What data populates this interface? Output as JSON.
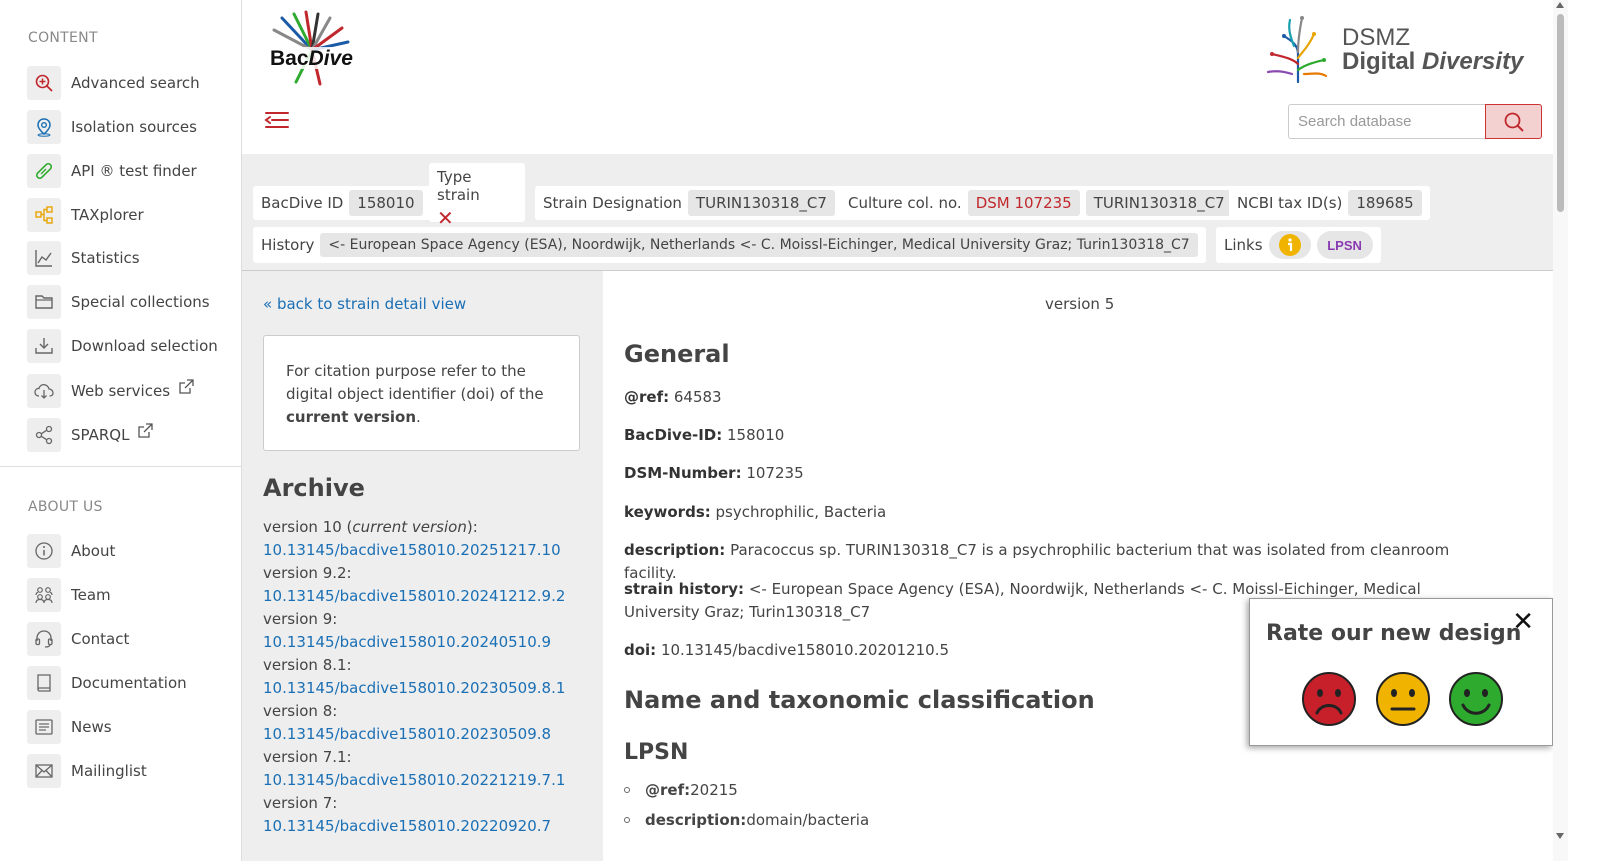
{
  "sidebar": {
    "content_heading": "CONTENT",
    "content_items": [
      {
        "label": "Advanced search",
        "icon": "search-plus-icon"
      },
      {
        "label": "Isolation sources",
        "icon": "location-pin-icon"
      },
      {
        "label": "API ® test finder",
        "icon": "test-tube-icon"
      },
      {
        "label": "TAXplorer",
        "icon": "tree-icon"
      },
      {
        "label": "Statistics",
        "icon": "line-chart-icon"
      },
      {
        "label": "Special collections",
        "icon": "folder-icon"
      },
      {
        "label": "Download selection",
        "icon": "download-icon"
      },
      {
        "label": "Web services",
        "icon": "cloud-download-icon"
      },
      {
        "label": "SPARQL",
        "icon": "share-nodes-icon"
      }
    ],
    "about_heading": "ABOUT US",
    "about_items": [
      {
        "label": "About",
        "icon": "info-icon"
      },
      {
        "label": "Team",
        "icon": "team-icon"
      },
      {
        "label": "Contact",
        "icon": "headset-icon"
      },
      {
        "label": "Documentation",
        "icon": "book-icon"
      },
      {
        "label": "News",
        "icon": "newspaper-icon"
      },
      {
        "label": "Mailinglist",
        "icon": "envelope-icon"
      }
    ]
  },
  "header": {
    "bacdive_logo_text": "BacDive",
    "dsmz_line1": "DSMZ",
    "dsmz_line2a": "Digital ",
    "dsmz_line2b": "Diversity",
    "search_placeholder": "Search database"
  },
  "infobar": {
    "bacdive_id_label": "BacDive ID",
    "bacdive_id_value": "158010",
    "type_strain_label": "Type strain",
    "type_strain_value": "✕",
    "strain_designation_label": "Strain Designation",
    "strain_designation_value": "TURIN130318_C7",
    "culture_col_label": "Culture col. no.",
    "culture_col_value1": "DSM 107235",
    "culture_col_value2": "TURIN130318_C7",
    "ncbi_label": "NCBI tax ID(s)",
    "ncbi_value": "189685",
    "history_label": "History",
    "history_value": "<- European Space Agency (ESA), Noordwijk, Netherlands <- C. Moissl-Eichinger, Medical University Graz; Turin130318_C7",
    "links_label": "Links",
    "lpsn_badge": "LPSN"
  },
  "archive": {
    "back_link": "« back to strain detail view",
    "citation_text_pre": "For citation purpose refer to the digital object identifier (doi) of the ",
    "citation_bold": "current version",
    "citation_end": ".",
    "title": "Archive",
    "versions": [
      {
        "label": "version 10 (",
        "italic": "current version",
        "suffix": "):",
        "doi": "10.13145/bacdive158010.20251217.10"
      },
      {
        "label": "version 9.2:",
        "italic": "",
        "suffix": "",
        "doi": "10.13145/bacdive158010.20241212.9.2"
      },
      {
        "label": "version 9:",
        "italic": "",
        "suffix": "",
        "doi": "10.13145/bacdive158010.20240510.9"
      },
      {
        "label": "version 8.1:",
        "italic": "",
        "suffix": "",
        "doi": "10.13145/bacdive158010.20230509.8.1"
      },
      {
        "label": "version 8:",
        "italic": "",
        "suffix": "",
        "doi": "10.13145/bacdive158010.20230509.8"
      },
      {
        "label": "version 7.1:",
        "italic": "",
        "suffix": "",
        "doi": "10.13145/bacdive158010.20221219.7.1"
      },
      {
        "label": "version 7:",
        "italic": "",
        "suffix": "",
        "doi": "10.13145/bacdive158010.20220920.7"
      }
    ]
  },
  "main": {
    "version_label": "version 5",
    "general_title": "General",
    "fields": [
      {
        "key": "@ref:",
        "value": " 64583"
      },
      {
        "key": "BacDive-ID:",
        "value": " 158010"
      },
      {
        "key": "DSM-Number:",
        "value": " 107235"
      },
      {
        "key": "keywords:",
        "value": " psychrophilic, Bacteria"
      },
      {
        "key": "description:",
        "value": " Paracoccus sp. TURIN130318_C7 is a psychrophilic bacterium that was isolated from cleanroom facility."
      },
      {
        "key": "strain history:",
        "value": " <- European Space Agency (ESA), Noordwijk, Netherlands <- C. Moissl-Eichinger, Medical University Graz; Turin130318_C7"
      },
      {
        "key": "doi:",
        "value": " 10.13145/bacdive158010.20201210.5"
      }
    ],
    "name_title": "Name and taxonomic classification",
    "lpsn_title": "LPSN",
    "lpsn_items": [
      {
        "key": "@ref:",
        "value": " 20215"
      },
      {
        "key": "description:",
        "value": " domain/bacteria"
      }
    ]
  },
  "rating": {
    "title": "Rate our new design",
    "close": "✕",
    "faces": [
      "sad-face-icon",
      "neutral-face-icon",
      "happy-face-icon"
    ]
  },
  "colors": {
    "accent_red": "#c0282d",
    "link_blue": "#1a6fb5",
    "sad": "#c8202a",
    "neutral": "#f0b400",
    "happy": "#2eaa2e"
  }
}
